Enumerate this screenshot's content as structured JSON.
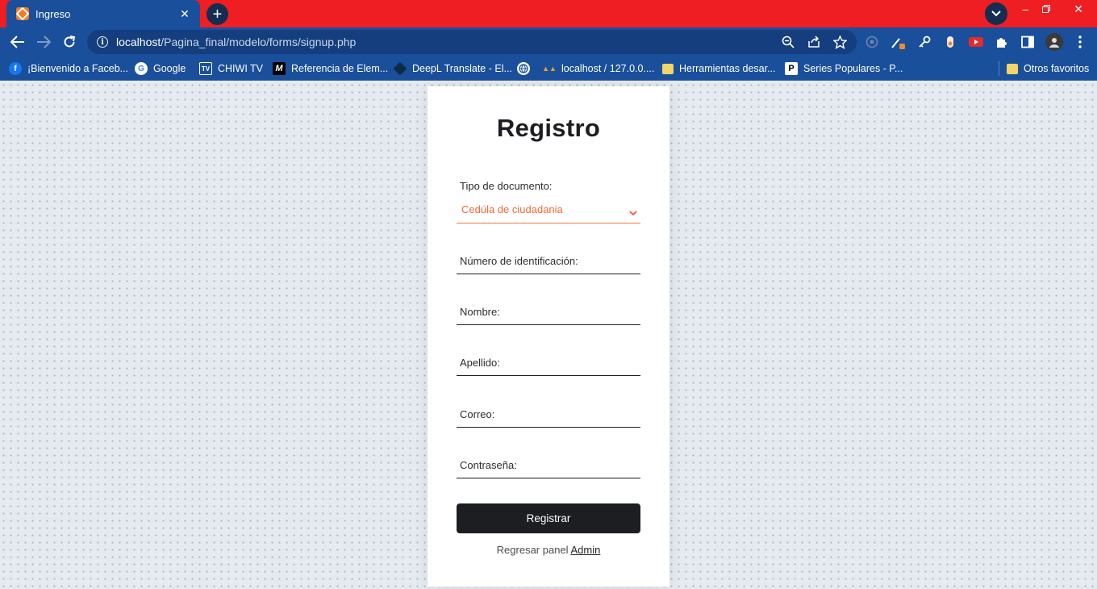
{
  "browser": {
    "tab": {
      "title": "Ingreso"
    },
    "address": {
      "host": "localhost",
      "path": "/Pagina_final/modelo/forms/signup.php"
    },
    "bookmarks": [
      {
        "label": "¡Bienvenido a Faceb...",
        "icon": "facebook-icon"
      },
      {
        "label": "Google",
        "icon": "google-icon"
      },
      {
        "label": "CHIWI TV",
        "icon": "tv-icon"
      },
      {
        "label": "Referencia de Elem...",
        "icon": "mdn-icon"
      },
      {
        "label": "DeepL Translate - El...",
        "icon": "deepl-icon"
      },
      {
        "label": "",
        "icon": "globe-icon"
      },
      {
        "label": "localhost / 127.0.0....",
        "icon": "phpmyadmin-icon"
      },
      {
        "label": "Herramientas desar...",
        "icon": "folder-icon"
      },
      {
        "label": "Series Populares - P...",
        "icon": "p-icon"
      }
    ],
    "other_bookmarks": "Otros favoritos"
  },
  "form": {
    "title": "Registro",
    "document_type": {
      "label": "Tipo de documento:",
      "selected": "Cedúla de ciudadania"
    },
    "fields": {
      "id_number": "Número de identificación:",
      "first_name": "Nombre:",
      "last_name": "Apellido:",
      "email": "Correo:",
      "password": "Contraseña:"
    },
    "submit_label": "Registrar",
    "footer_text": "Regresar panel",
    "footer_link": "Admin"
  },
  "colors": {
    "tabstrip": "#ee1e22",
    "toolbar": "#1a4f9c",
    "accent_orange": "#f26a3a",
    "button_dark": "#1c1e22"
  }
}
